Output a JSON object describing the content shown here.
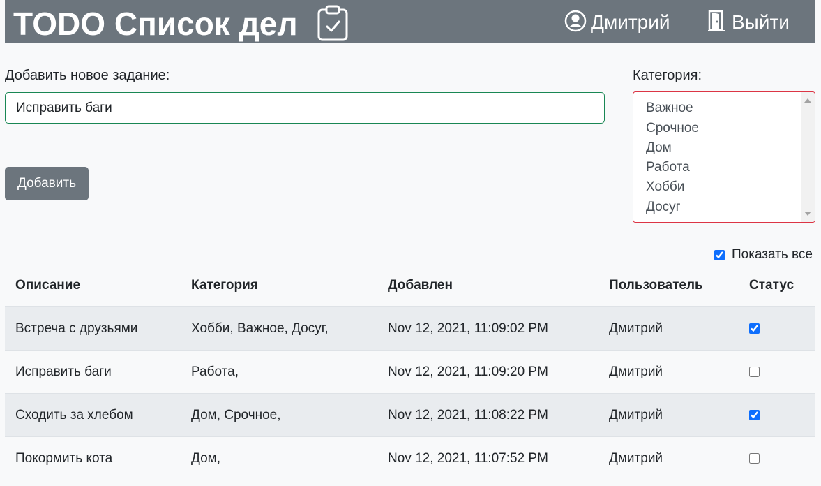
{
  "header": {
    "title": "TODO Список дел",
    "user_name": "Дмитрий",
    "logout_label": "Выйти",
    "bg_color": "#6c757d"
  },
  "form": {
    "task_label": "Добавить новое задание:",
    "task_value": "Исправить баги",
    "add_button": "Добавить",
    "category_label": "Категория:",
    "categories": [
      "Важное",
      "Срочное",
      "Дом",
      "Работа",
      "Хобби",
      "Досуг"
    ]
  },
  "show_all": {
    "label": "Показать все",
    "checked": true
  },
  "table": {
    "headers": [
      "Описание",
      "Категория",
      "Добавлен",
      "Пользователь",
      "Статус"
    ],
    "rows": [
      {
        "description": "Встреча с друзьями",
        "category": "Хобби, Важное, Досуг,",
        "added": "Nov 12, 2021, 11:09:02 PM",
        "user": "Дмитрий",
        "done": true
      },
      {
        "description": "Исправить баги",
        "category": "Работа,",
        "added": "Nov 12, 2021, 11:09:20 PM",
        "user": "Дмитрий",
        "done": false
      },
      {
        "description": "Сходить за хлебом",
        "category": "Дом, Срочное,",
        "added": "Nov 12, 2021, 11:08:22 PM",
        "user": "Дмитрий",
        "done": true
      },
      {
        "description": "Покормить кота",
        "category": "Дом,",
        "added": "Nov 12, 2021, 11:07:52 PM",
        "user": "Дмитрий",
        "done": false
      }
    ]
  },
  "icons": {
    "title": "clipboard-check-icon",
    "user": "person-circle-icon",
    "logout": "door-open-icon"
  },
  "colors": {
    "input_border": "#198754",
    "select_border": "#dc3545",
    "checkbox": "#0d6efd",
    "stripe": "#e9ecef"
  }
}
